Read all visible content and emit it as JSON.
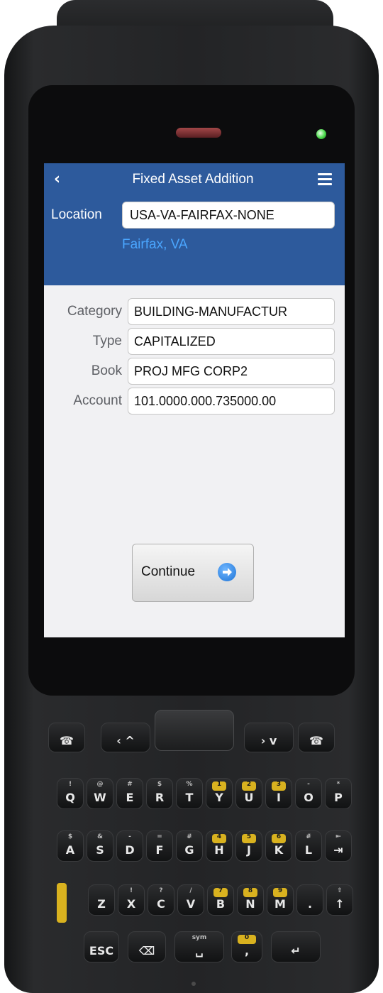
{
  "app": {
    "title": "Fixed Asset Addition",
    "back_icon": "chevron-left-icon",
    "menu_icon": "hamburger-menu-icon"
  },
  "location": {
    "label": "Location",
    "value": "USA-VA-FAIRFAX-NONE",
    "description": "Fairfax, VA"
  },
  "fields": [
    {
      "label": "Category",
      "value": "BUILDING-MANUFACTUR"
    },
    {
      "label": "Type",
      "value": "CAPITALIZED"
    },
    {
      "label": "Book",
      "value": "PROJ MFG CORP2"
    },
    {
      "label": "Account",
      "value": "101.0000.000.735000.00"
    }
  ],
  "actions": {
    "continue_label": "Continue",
    "continue_icon": "arrow-right-circle-icon"
  },
  "colors": {
    "header_bg": "#2d5a9c",
    "location_desc": "#4aa6ff",
    "screen_bg": "#f1f1f3"
  },
  "keypad": {
    "row1": [
      {
        "main": "Q",
        "top": "!"
      },
      {
        "main": "W",
        "top": "@"
      },
      {
        "main": "E",
        "top": "#"
      },
      {
        "main": "R",
        "top": "$"
      },
      {
        "main": "T",
        "top": "%"
      },
      {
        "main": "Y",
        "top": "1"
      },
      {
        "main": "U",
        "top": "2"
      },
      {
        "main": "I",
        "top": "3"
      },
      {
        "main": "O",
        "top": "-"
      },
      {
        "main": "P",
        "top": "*"
      }
    ],
    "row2": [
      {
        "main": "A",
        "top": "$"
      },
      {
        "main": "S",
        "top": "&"
      },
      {
        "main": "D",
        "top": "-"
      },
      {
        "main": "F",
        "top": "="
      },
      {
        "main": "G",
        "top": "#"
      },
      {
        "main": "H",
        "top": "4"
      },
      {
        "main": "J",
        "top": "5"
      },
      {
        "main": "K",
        "top": "6"
      },
      {
        "main": "L",
        "top": "#"
      },
      {
        "main": "⇥",
        "top": "⇤"
      }
    ],
    "row3": [
      {
        "main": "Z",
        "top": ""
      },
      {
        "main": "X",
        "top": "!"
      },
      {
        "main": "C",
        "top": "?"
      },
      {
        "main": "V",
        "top": "/"
      },
      {
        "main": "B",
        "top": "7"
      },
      {
        "main": "N",
        "top": "8"
      },
      {
        "main": "M",
        "top": "9"
      },
      {
        "main": ".",
        "top": ""
      },
      {
        "main": "↑",
        "top": "⇧"
      }
    ],
    "row4": [
      {
        "main": "ESC",
        "top": ""
      },
      {
        "main": "⌫",
        "top": ""
      },
      {
        "main": "␣",
        "top": "sym"
      },
      {
        "main": ",",
        "top": "0"
      },
      {
        "main": "↵",
        "top": ""
      }
    ]
  }
}
